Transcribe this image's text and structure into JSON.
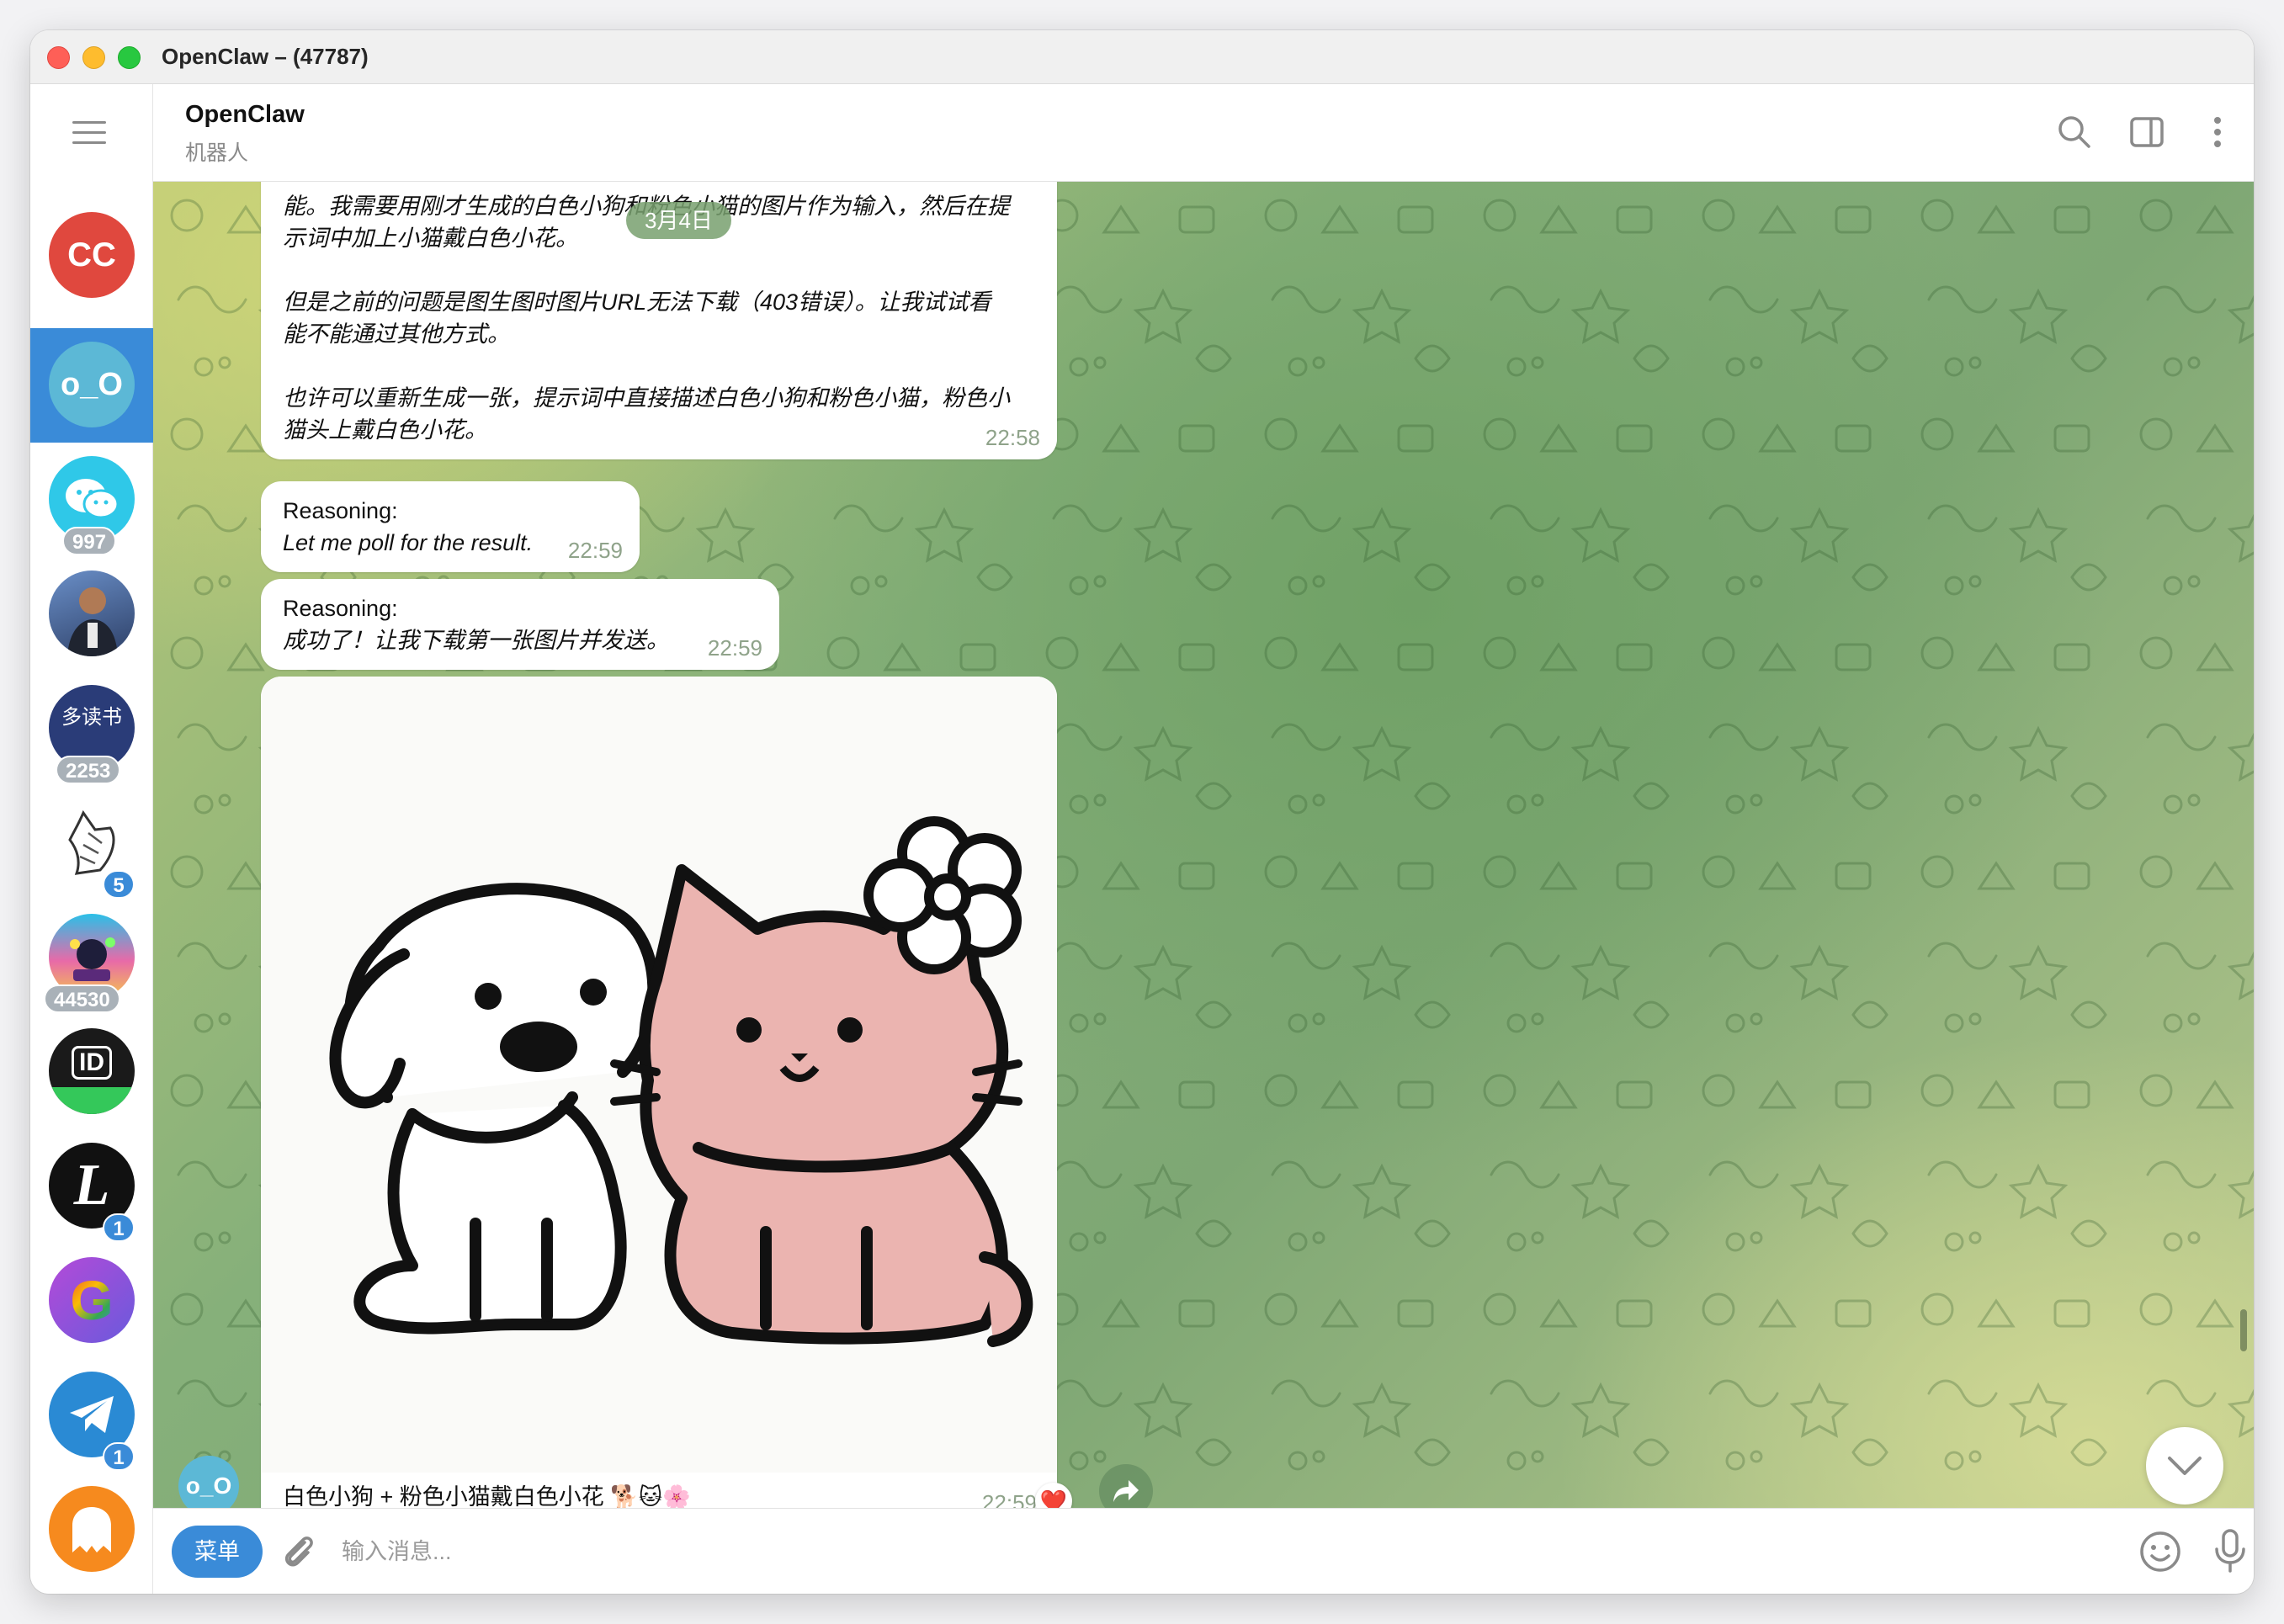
{
  "window": {
    "title": "OpenClaw – (47787)"
  },
  "header": {
    "name": "OpenClaw",
    "subtitle": "机器人"
  },
  "sidebar": {
    "chats": [
      {
        "id": "cc",
        "initials": "CC",
        "color": "#e0483e",
        "badge": ""
      },
      {
        "id": "openclaw",
        "initials": "o_O",
        "color": "#5cb8d6",
        "badge": "",
        "active": true
      },
      {
        "id": "wechat",
        "initials": "",
        "color": "#2fc8e8",
        "badge": "997"
      },
      {
        "id": "person",
        "initials": "",
        "color": "#3b5c8c",
        "badge": ""
      },
      {
        "id": "reading",
        "initials": "多读书",
        "color": "#2a3c78",
        "badge": "2253"
      },
      {
        "id": "unicorn",
        "initials": "",
        "color": "#ffffff",
        "badge": "5"
      },
      {
        "id": "party",
        "initials": "",
        "color": "#e86aa8",
        "badge": "44530"
      },
      {
        "id": "id-bot",
        "initials": "ID",
        "color": "#1a1a1a",
        "badge": ""
      },
      {
        "id": "l-bot",
        "initials": "L",
        "color": "#111111",
        "badge": "1"
      },
      {
        "id": "google",
        "initials": "G",
        "color": "#8e4fd8",
        "badge": ""
      },
      {
        "id": "telegram",
        "initials": "",
        "color": "#2a8ad4",
        "badge": "1"
      },
      {
        "id": "ghost",
        "initials": "",
        "color": "#f68a1e",
        "badge": ""
      }
    ]
  },
  "messages": {
    "m1_line1": "能。我需要用刚才生成的白色小狗和粉色小猫的图片作为输入，然后在提",
    "m1_line2": "示词中加上小猫戴白色小花。",
    "m1_para2_line1": "但是之前的问题是图生图时图片URL无法下载（403错误）。让我试试看",
    "m1_para2_line2": "能不能通过其他方式。",
    "m1_para3_line1": "也许可以重新生成一张，提示词中直接描述白色小狗和粉色小猫，粉色小",
    "m1_para3_line2": "猫头上戴白色小花。",
    "m1_time": "22:58",
    "date_pill": "3月4日",
    "m2_title": "Reasoning:",
    "m2_body": "Let me poll for the result.",
    "m2_time": "22:59",
    "m3_title": "Reasoning:",
    "m3_body": "成功了！让我下载第一张图片并发送。",
    "m3_time": "22:59",
    "m4_caption": "白色小狗 + 粉色小猫戴白色小花 🐕🐱🌸",
    "m4_time": "22:59",
    "m4_reaction": "❤️",
    "sender_avatar": "o_O"
  },
  "composer": {
    "menu_label": "菜单",
    "placeholder": "输入消息..."
  }
}
